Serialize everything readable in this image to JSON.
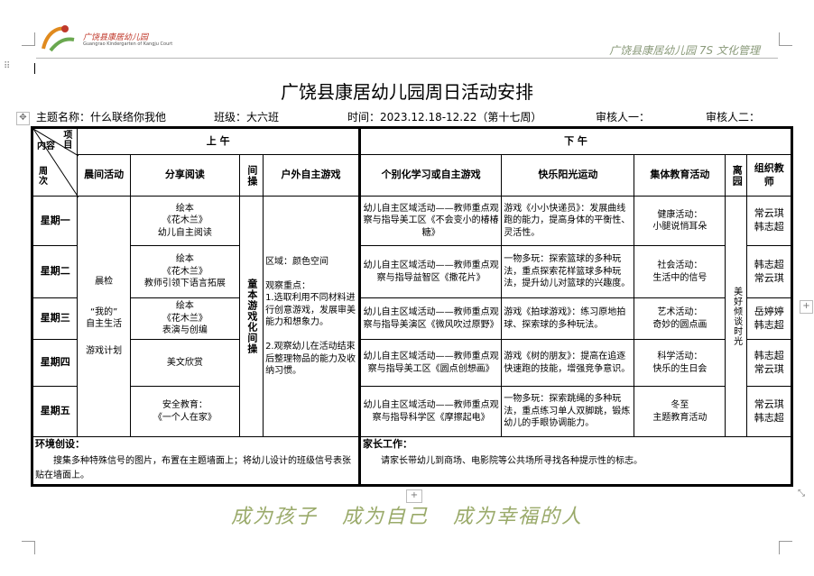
{
  "header": {
    "logo_text": "广饶县康居幼儿园",
    "logo_sub": "Guangrao Kindergarten of Kangju Court",
    "right_text": "广饶县康居幼儿园 7S 文化管理"
  },
  "title": "广饶县康居幼儿园周日活动安排",
  "meta": {
    "theme": "主题名称：什么联络你我他",
    "class": "班级：大六班",
    "time": "时间：2023.12.18-12.22（第十七周）",
    "reviewer1": "审核人一：",
    "reviewer2": "审核人二："
  },
  "table": {
    "corner": {
      "top": "项目",
      "mid": "内容",
      "bottom": "周次"
    },
    "am_label": "上 午",
    "pm_label": "下 午",
    "cols": {
      "morning": "晨间活动",
      "reading": "分享阅读",
      "exercise": "间操",
      "outdoor": "户外自主游戏",
      "individual": "个别化学习或自主游戏",
      "sunshine": "快乐阳光运动",
      "collective": "集体教育活动",
      "leave": "离园",
      "teacher": "组织教师"
    },
    "days": [
      "星期一",
      "星期二",
      "星期三",
      "星期四",
      "星期五"
    ],
    "morning_text": {
      "a": "晨检",
      "b": "“我的”",
      "c": "自主生活",
      "d": "游戏计划"
    },
    "reading": [
      "绘本\n《花木兰》\n幼儿自主阅读",
      "绘本\n《花木兰》\n教师引领下语言拓展",
      "绘本\n《花木兰》\n表演与创编",
      "美文欣赏",
      "安全教育：\n《一个人在家》"
    ],
    "exercise_text": "童本游戏化间操",
    "outdoor_text": "区域：颜色空间\n\n观察重点：\n1.选取利用不同材料进行创意游戏，发展审美能力和想象力。\n\n2.观察幼儿在活动结束后整理物品的能力及收纳习惯。",
    "individual": [
      "幼儿自主区域活动——教师重点观察与指导美工区《不会变小的椿椿糖》",
      "幼儿自主区域活动——教师重点观察与指导益智区《撒花片》",
      "幼儿自主区域活动——教师重点观察与指导美演区《微风吹过原野》",
      "幼儿自主区域活动——教师重点观察与指导美工区《圆点创想画》",
      "幼儿自主区域活动——教师重点观察与指导科学区《摩擦起电》"
    ],
    "sunshine": [
      "游戏《小小快递员》：发展曲线跑的能力，提高身体的平衡性、灵活性。",
      "一物多玩：探索篮球的多种玩法，重点探索花样篮球多种玩法，提升幼儿对篮球的兴趣度。",
      "游戏《拍球游戏》：练习原地拍球、探索球的多种玩法。",
      "游戏《树的朋友》：提高在追逐快速跑的技能，增强竞争意识。",
      "一物多玩：探索跳绳的多种玩法，重点练习单人双脚跳，锻炼幼儿的手眼协调能力。"
    ],
    "collective": [
      "健康活动：\n小腿说悄耳朵",
      "社会活动：\n生活中的信号",
      "艺术活动：\n奇妙的圆点画",
      "科学活动：\n快乐的生日会",
      "冬至\n主题教育活动"
    ],
    "leave_text": "美好倾谈时光",
    "teachers": [
      "常云琪\n韩志超",
      "韩志超\n常云琪",
      "岳婷婷\n韩志超",
      "韩志超\n常云琪",
      "常云琪\n韩志超"
    ],
    "env_title": "环境创设：",
    "env_text": "搜集多种特殊信号的图片，布置在主题墙面上；将幼儿设计的班级信号表张贴在墙面上。",
    "home_title": "家长工作：",
    "home_text": "请家长带幼儿到商场、电影院等公共场所寻找各种提示性的标志。"
  },
  "slogan": "成为孩子 成为自己 成为幸福的人"
}
